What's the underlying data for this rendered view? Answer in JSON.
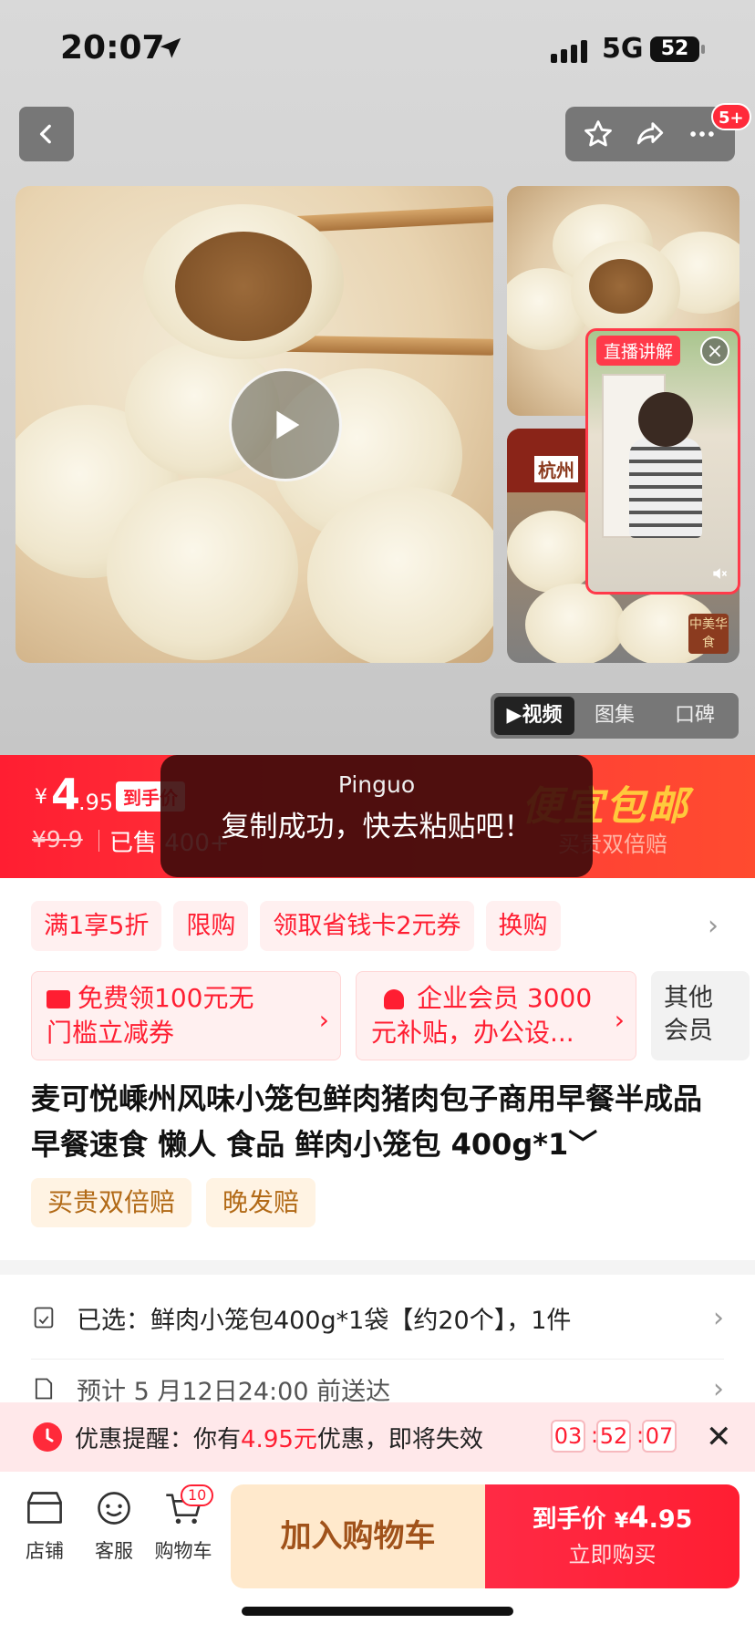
{
  "status_bar": {
    "time": "20:07",
    "network": "5G",
    "battery": "52"
  },
  "header": {
    "notif_badge": "5+"
  },
  "media": {
    "live_label": "直播讲解",
    "thumb_tag": "杭州",
    "seal_text": "中美华食",
    "tabs": [
      "▶视频",
      "图集",
      "口碑"
    ],
    "active_tab": 0
  },
  "price_bar": {
    "currency": "¥",
    "price_int": "4",
    "price_dec": ".95",
    "price_tag": "到手价",
    "original_price": "¥9.9",
    "sold": "已售 400+",
    "slogan": "便宜包邮",
    "slogan_sub": "买贵双倍赔"
  },
  "toast": {
    "app": "Pinguo",
    "message": "复制成功，快去粘贴吧！"
  },
  "promotions": {
    "chips": [
      "满1享5折",
      "限购",
      "领取省钱卡2元券",
      "换购"
    ],
    "coupon1": {
      "line1": "免费领100元无",
      "line2": "门槛立减券"
    },
    "coupon2": {
      "line1": "企业会员 3000",
      "line2": "元补贴，办公设..."
    },
    "other": {
      "line1": "其他",
      "line2": "会员"
    }
  },
  "product": {
    "title": "麦可悦嵊州风味小笼包鲜肉猪肉包子商用早餐半成品早餐速食 懒人 食品 鲜肉小笼包 400g*1﹀",
    "guarantees": [
      "买贵双倍赔",
      "晚发赔"
    ]
  },
  "selection": {
    "text": "已选：鲜肉小笼包400g*1袋【约20个】，1件"
  },
  "delivery": {
    "text": "预计 5 月12日24:00 前送达"
  },
  "reminder": {
    "prefix": "优惠提醒：你有",
    "amount": "4.95元",
    "suffix": "优惠，即将失效",
    "countdown": [
      "03",
      "52",
      "07"
    ]
  },
  "bottom_bar": {
    "store": "店铺",
    "service": "客服",
    "cart": "购物车",
    "cart_count": "10",
    "add_to_cart": "加入购物车",
    "buy_label": "到手价 ",
    "buy_currency": "¥",
    "buy_price": "4",
    "buy_dec": ".95",
    "buy_now": "立即购买"
  },
  "colors": {
    "accent": "#ff1e32",
    "gold": "#ffc93c",
    "cart_bg": "#ffe9cc"
  }
}
